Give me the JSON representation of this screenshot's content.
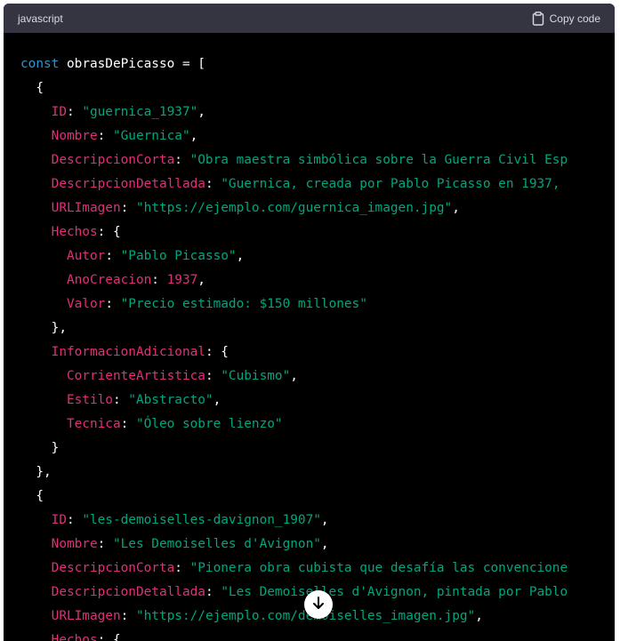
{
  "header": {
    "language": "javascript",
    "copy_label": "Copy code"
  },
  "code_lines": [
    [
      {
        "t": "kw",
        "v": "const"
      },
      {
        "t": "ident",
        "v": " obrasDePicasso = ["
      }
    ],
    [
      {
        "t": "ident",
        "v": "  {"
      }
    ],
    [
      {
        "t": "ident",
        "v": "    "
      },
      {
        "t": "prop",
        "v": "ID"
      },
      {
        "t": "ident",
        "v": ": "
      },
      {
        "t": "str",
        "v": "\"guernica_1937\""
      },
      {
        "t": "ident",
        "v": ","
      }
    ],
    [
      {
        "t": "ident",
        "v": "    "
      },
      {
        "t": "prop",
        "v": "Nombre"
      },
      {
        "t": "ident",
        "v": ": "
      },
      {
        "t": "str",
        "v": "\"Guernica\""
      },
      {
        "t": "ident",
        "v": ","
      }
    ],
    [
      {
        "t": "ident",
        "v": "    "
      },
      {
        "t": "prop",
        "v": "DescripcionCorta"
      },
      {
        "t": "ident",
        "v": ": "
      },
      {
        "t": "str",
        "v": "\"Obra maestra simbólica sobre la Guerra Civil Esp"
      }
    ],
    [
      {
        "t": "ident",
        "v": "    "
      },
      {
        "t": "prop",
        "v": "DescripcionDetallada"
      },
      {
        "t": "ident",
        "v": ": "
      },
      {
        "t": "str",
        "v": "\"Guernica, creada por Pablo Picasso en 1937,"
      }
    ],
    [
      {
        "t": "ident",
        "v": "    "
      },
      {
        "t": "prop",
        "v": "URLImagen"
      },
      {
        "t": "ident",
        "v": ": "
      },
      {
        "t": "str",
        "v": "\"https://ejemplo.com/guernica_imagen.jpg\""
      },
      {
        "t": "ident",
        "v": ","
      }
    ],
    [
      {
        "t": "ident",
        "v": "    "
      },
      {
        "t": "prop",
        "v": "Hechos"
      },
      {
        "t": "ident",
        "v": ": {"
      }
    ],
    [
      {
        "t": "ident",
        "v": "      "
      },
      {
        "t": "prop",
        "v": "Autor"
      },
      {
        "t": "ident",
        "v": ": "
      },
      {
        "t": "str",
        "v": "\"Pablo Picasso\""
      },
      {
        "t": "ident",
        "v": ","
      }
    ],
    [
      {
        "t": "ident",
        "v": "      "
      },
      {
        "t": "prop",
        "v": "AnoCreacion"
      },
      {
        "t": "ident",
        "v": ": "
      },
      {
        "t": "num",
        "v": "1937"
      },
      {
        "t": "ident",
        "v": ","
      }
    ],
    [
      {
        "t": "ident",
        "v": "      "
      },
      {
        "t": "prop",
        "v": "Valor"
      },
      {
        "t": "ident",
        "v": ": "
      },
      {
        "t": "str",
        "v": "\"Precio estimado: $150 millones\""
      }
    ],
    [
      {
        "t": "ident",
        "v": "    },"
      }
    ],
    [
      {
        "t": "ident",
        "v": "    "
      },
      {
        "t": "prop",
        "v": "InformacionAdicional"
      },
      {
        "t": "ident",
        "v": ": {"
      }
    ],
    [
      {
        "t": "ident",
        "v": "      "
      },
      {
        "t": "prop",
        "v": "CorrienteArtistica"
      },
      {
        "t": "ident",
        "v": ": "
      },
      {
        "t": "str",
        "v": "\"Cubismo\""
      },
      {
        "t": "ident",
        "v": ","
      }
    ],
    [
      {
        "t": "ident",
        "v": "      "
      },
      {
        "t": "prop",
        "v": "Estilo"
      },
      {
        "t": "ident",
        "v": ": "
      },
      {
        "t": "str",
        "v": "\"Abstracto\""
      },
      {
        "t": "ident",
        "v": ","
      }
    ],
    [
      {
        "t": "ident",
        "v": "      "
      },
      {
        "t": "prop",
        "v": "Tecnica"
      },
      {
        "t": "ident",
        "v": ": "
      },
      {
        "t": "str",
        "v": "\"Óleo sobre lienzo\""
      }
    ],
    [
      {
        "t": "ident",
        "v": "    }"
      }
    ],
    [
      {
        "t": "ident",
        "v": "  },"
      }
    ],
    [
      {
        "t": "ident",
        "v": "  {"
      }
    ],
    [
      {
        "t": "ident",
        "v": "    "
      },
      {
        "t": "prop",
        "v": "ID"
      },
      {
        "t": "ident",
        "v": ": "
      },
      {
        "t": "str",
        "v": "\"les-demoiselles-davignon_1907\""
      },
      {
        "t": "ident",
        "v": ","
      }
    ],
    [
      {
        "t": "ident",
        "v": "    "
      },
      {
        "t": "prop",
        "v": "Nombre"
      },
      {
        "t": "ident",
        "v": ": "
      },
      {
        "t": "str",
        "v": "\"Les Demoiselles d'Avignon\""
      },
      {
        "t": "ident",
        "v": ","
      }
    ],
    [
      {
        "t": "ident",
        "v": "    "
      },
      {
        "t": "prop",
        "v": "DescripcionCorta"
      },
      {
        "t": "ident",
        "v": ": "
      },
      {
        "t": "str",
        "v": "\"Pionera obra cubista que desafía las convencione"
      }
    ],
    [
      {
        "t": "ident",
        "v": "    "
      },
      {
        "t": "prop",
        "v": "DescripcionDetallada"
      },
      {
        "t": "ident",
        "v": ": "
      },
      {
        "t": "str",
        "v": "\"Les Demoiselles d'Avignon, pintada por Pablo"
      }
    ],
    [
      {
        "t": "ident",
        "v": "    "
      },
      {
        "t": "prop",
        "v": "URLImagen"
      },
      {
        "t": "ident",
        "v": ": "
      },
      {
        "t": "str",
        "v": "\"https://ejemplo.com/demoiselles_imagen.jpg\""
      },
      {
        "t": "ident",
        "v": ","
      }
    ],
    [
      {
        "t": "ident",
        "v": "    "
      },
      {
        "t": "prop",
        "v": "Hechos"
      },
      {
        "t": "ident",
        "v": ": {"
      }
    ]
  ],
  "colors": {
    "background": "#000000",
    "header_background": "#343541",
    "keyword": "#2e95d3",
    "property": "#df3079",
    "string": "#00a67d"
  },
  "icons": {
    "copy": "clipboard-icon",
    "scroll": "arrow-down-icon"
  }
}
